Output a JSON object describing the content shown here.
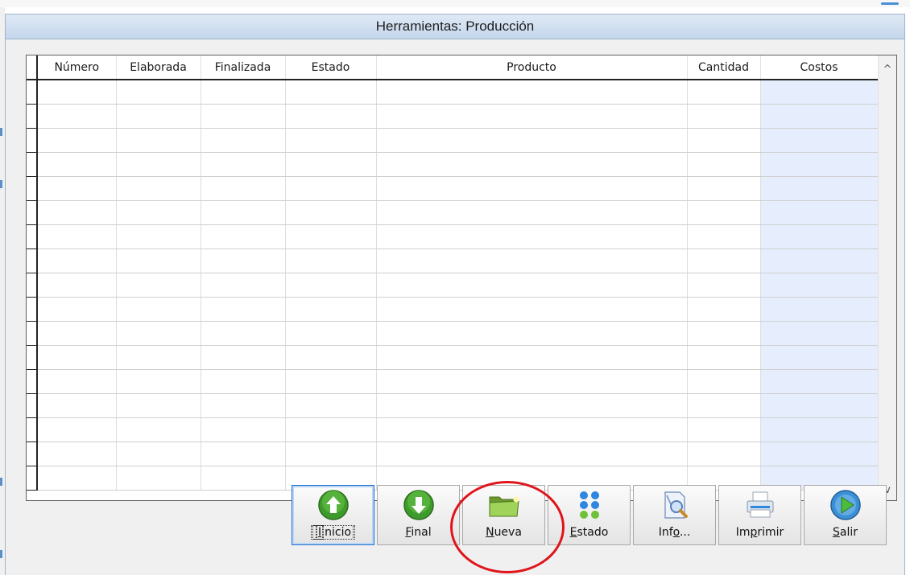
{
  "window": {
    "title": "Herramientas: Producción"
  },
  "table": {
    "columns": [
      "Número",
      "Elaborada",
      "Finalizada",
      "Estado",
      "Producto",
      "Cantidad",
      "Costos"
    ],
    "rows": [
      [],
      [],
      [],
      [],
      [],
      [],
      [],
      [],
      [],
      [],
      [],
      [],
      [],
      [],
      [],
      [],
      []
    ]
  },
  "toolbar": {
    "buttons": [
      {
        "pre": "",
        "mn": "I",
        "post": "nicio",
        "icon": "up-arrow-circle-icon"
      },
      {
        "pre": "",
        "mn": "F",
        "post": "inal",
        "icon": "down-arrow-circle-icon"
      },
      {
        "pre": "",
        "mn": "N",
        "post": "ueva",
        "icon": "new-folder-icon"
      },
      {
        "pre": "",
        "mn": "E",
        "post": "stado",
        "icon": "status-balls-icon"
      },
      {
        "pre": "Inf",
        "mn": "o",
        "post": "...",
        "icon": "info-magnifier-icon"
      },
      {
        "pre": "Im",
        "mn": "p",
        "post": "rimir",
        "icon": "printer-icon"
      },
      {
        "pre": "",
        "mn": "S",
        "post": "alir",
        "icon": "play-exit-icon"
      }
    ]
  },
  "scroll": {
    "up": "^",
    "down": "v"
  },
  "colors": {
    "accent_circle": "#e0141b",
    "cost_column": "#e6eefd",
    "titlebar": "#c4d6ec"
  }
}
